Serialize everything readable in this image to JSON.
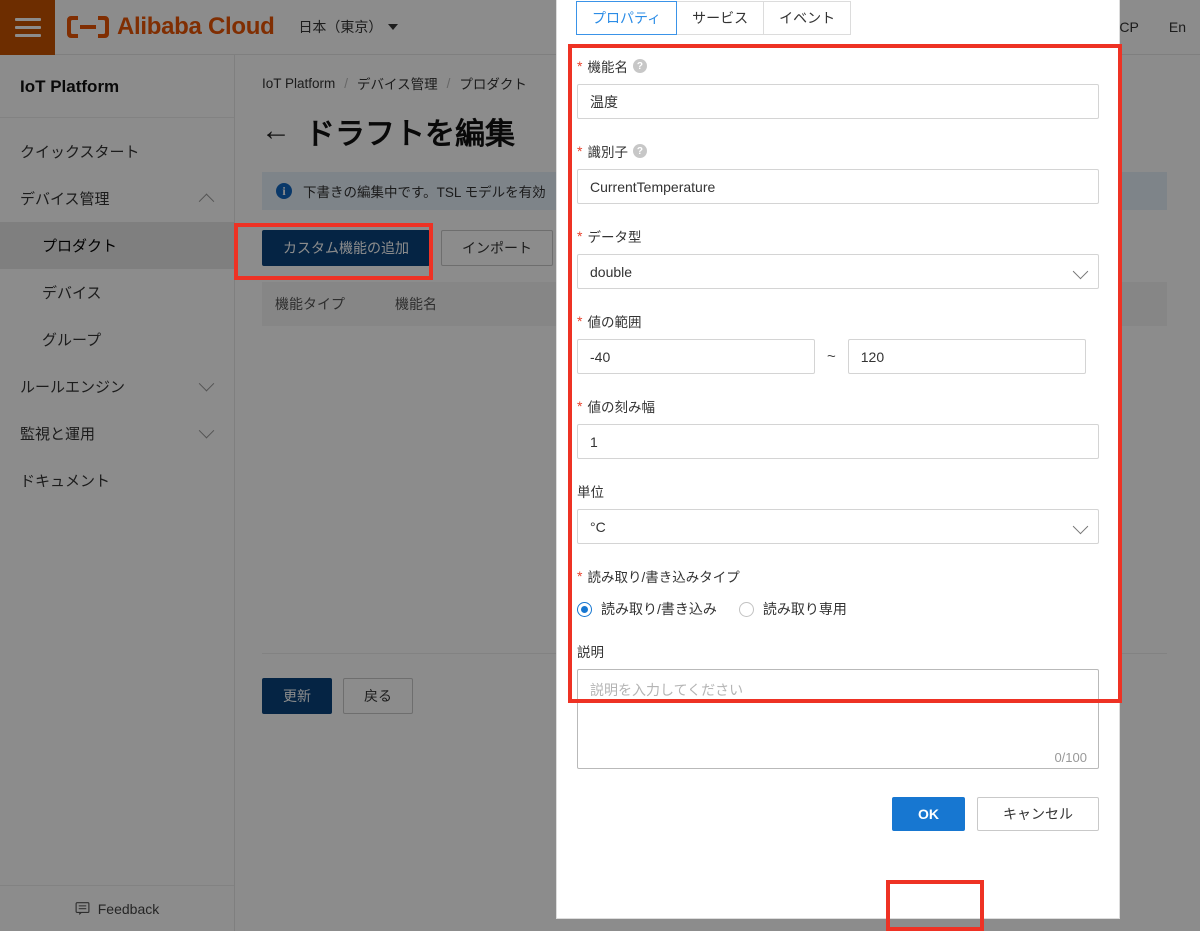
{
  "topnav": {
    "hamburger_icon": "hamburger-menu-icon",
    "brand": "Alibaba Cloud",
    "region": "日本（東京）",
    "right_items": [
      "ICP",
      "En"
    ]
  },
  "sidebar": {
    "title": "IoT Platform",
    "items": [
      {
        "label": "クイックスタート",
        "level": "top",
        "chevron": "",
        "active": false
      },
      {
        "label": "デバイス管理",
        "level": "top",
        "chevron": "up",
        "active": false
      },
      {
        "label": "プロダクト",
        "level": "sub",
        "chevron": "",
        "active": true
      },
      {
        "label": "デバイス",
        "level": "sub",
        "chevron": "",
        "active": false
      },
      {
        "label": "グループ",
        "level": "sub",
        "chevron": "",
        "active": false
      },
      {
        "label": "ルールエンジン",
        "level": "top",
        "chevron": "down",
        "active": false
      },
      {
        "label": "監視と運用",
        "level": "top",
        "chevron": "down",
        "active": false
      },
      {
        "label": "ドキュメント",
        "level": "top",
        "chevron": "",
        "active": false
      }
    ],
    "feedback_label": "Feedback",
    "feedback_icon": "feedback-bubble-icon"
  },
  "main": {
    "breadcrumb": [
      "IoT Platform",
      "デバイス管理",
      "プロダクト"
    ],
    "back_arrow": "←",
    "page_title": "ドラフトを編集",
    "info_banner": "下書きの編集中です。TSL モデルを有効",
    "buttons": {
      "add_custom_feature": "カスタム機能の追加",
      "import": "インポート"
    },
    "table_headers": [
      "機能タイプ",
      "機能名"
    ],
    "footer_buttons": {
      "update": "更新",
      "back": "戻る"
    }
  },
  "modal": {
    "tabs": [
      {
        "label": "プロパティ",
        "active": true
      },
      {
        "label": "サービス",
        "active": false
      },
      {
        "label": "イベント",
        "active": false
      }
    ],
    "fields": {
      "feature_name": {
        "label": "機能名",
        "required": true,
        "help": true,
        "value": "温度"
      },
      "identifier": {
        "label": "識別子",
        "required": true,
        "help": true,
        "value": "CurrentTemperature"
      },
      "data_type": {
        "label": "データ型",
        "required": true,
        "value": "double"
      },
      "value_range": {
        "label": "値の範囲",
        "required": true,
        "min": "-40",
        "separator": "~",
        "max": "120"
      },
      "step": {
        "label": "値の刻み幅",
        "required": true,
        "value": "1"
      },
      "unit": {
        "label": "単位",
        "required": false,
        "value": "°C"
      },
      "read_write_type": {
        "label": "読み取り/書き込みタイプ",
        "required": true,
        "options": [
          {
            "label": "読み取り/書き込み",
            "selected": true
          },
          {
            "label": "読み取り専用",
            "selected": false
          }
        ]
      },
      "description": {
        "label": "説明",
        "required": false,
        "value": "",
        "placeholder": "説明を入力してください",
        "counter": "0/100"
      }
    },
    "footer": {
      "ok": "OK",
      "cancel": "キャンセル"
    }
  },
  "annotations": {
    "add_feature_box": "highlight-add-custom-feature-button",
    "form_fields_box": "highlight-property-form-fields",
    "ok_box": "highlight-ok-button"
  },
  "colors": {
    "brand_orange": "#ea5504",
    "hamburger_orange": "#c75300",
    "primary_dark_blue": "#0a437c",
    "primary_blue": "#1777d1",
    "annotation_red": "#ee3224",
    "tab_active_blue": "#2b8ce6"
  }
}
